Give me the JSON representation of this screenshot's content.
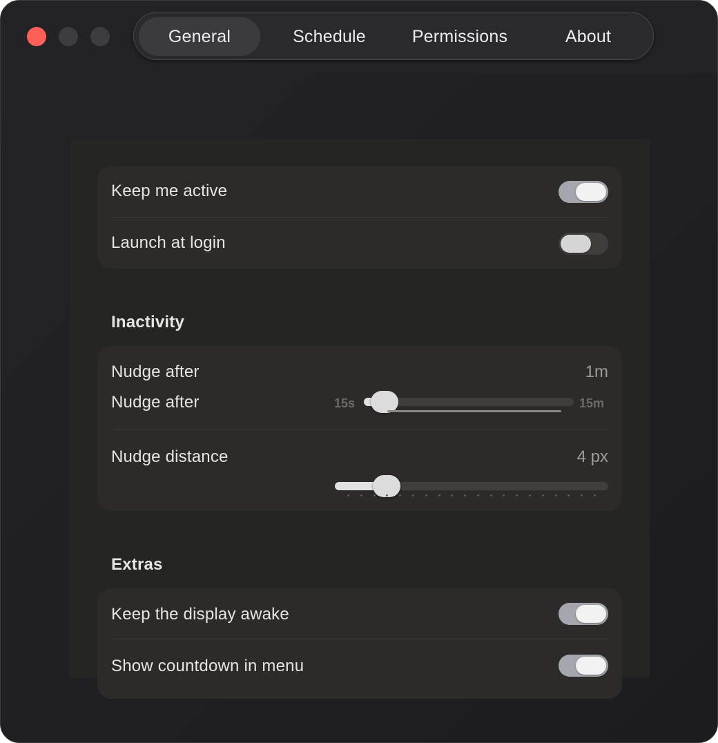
{
  "window": {
    "controls": [
      "close",
      "minimize",
      "maximize"
    ]
  },
  "tabs": [
    {
      "label": "General",
      "active": true
    },
    {
      "label": "Schedule",
      "active": false
    },
    {
      "label": "Permissions",
      "active": false
    },
    {
      "label": "About",
      "active": false
    }
  ],
  "general": {
    "keep_active": {
      "label": "Keep me active",
      "on": true
    },
    "launch_login": {
      "label": "Launch at login",
      "on": false
    }
  },
  "inactivity": {
    "title": "Inactivity",
    "nudge_after": {
      "label": "Nudge after",
      "value": "1m",
      "slider_label": "Nudge after",
      "min_label": "15s",
      "max_label": "15m",
      "fraction": 0.1
    },
    "nudge_distance": {
      "label": "Nudge distance",
      "value": "4 px",
      "fraction": 0.19,
      "tick_count": 20
    }
  },
  "extras": {
    "title": "Extras",
    "display_awake": {
      "label": "Keep the display awake",
      "on": true
    },
    "countdown": {
      "label": "Show countdown in menu",
      "on": true
    }
  },
  "colors": {
    "close": "#fe5f57",
    "toggle_on": "#a5a6ad",
    "toggle_off": "#3f3e3b"
  }
}
